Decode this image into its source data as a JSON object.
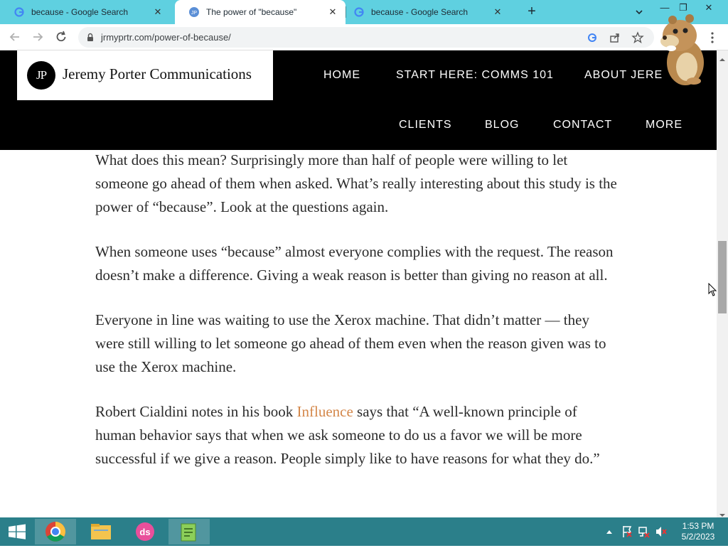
{
  "browser": {
    "tabs": [
      {
        "title": "because - Google Search",
        "active": false
      },
      {
        "title": "The power of \"because\"",
        "active": true
      },
      {
        "title": "because - Google Search",
        "active": false
      }
    ],
    "new_tab_label": "+",
    "url": "jrmyprtr.com/power-of-because/"
  },
  "site": {
    "logo_mark": "JP",
    "logo_text": "Jeremy Porter Communications",
    "nav": {
      "home": "HOME",
      "start_here": "START HERE: COMMS 101",
      "about": "ABOUT JERE",
      "clients": "CLIENTS",
      "blog": "BLOG",
      "contact": "CONTACT",
      "more": "MORE"
    }
  },
  "article": {
    "p1": "What does this mean? Surprisingly more than half of people were willing to let someone go ahead of them when asked. What’s really interesting about this study is the power of “because”. Look at the questions again.",
    "p2": "When someone uses “because” almost everyone complies with the request. The reason doesn’t make a difference. Giving a weak reason is better than giving no reason at all.",
    "p3": "Everyone in line was waiting to use the Xerox machine. That didn’t matter — they were still willing to let someone go ahead of them even when the reason given was to use the Xerox machine.",
    "p4_before": "Robert Cialdini notes in his book ",
    "p4_link": "Influence",
    "p4_after": " says that “A well-known principle of human behavior says that when we ask someone to do us a favor we will be more successful if we give a reason. People simply like to have reasons for what they do.”"
  },
  "taskbar": {
    "time": "1:53 PM",
    "date": "5/2/2023"
  },
  "colors": {
    "tabstrip": "#5fd0e0",
    "site_header": "#000000",
    "link": "#d4874a",
    "taskbar": "#2b7f8a"
  }
}
